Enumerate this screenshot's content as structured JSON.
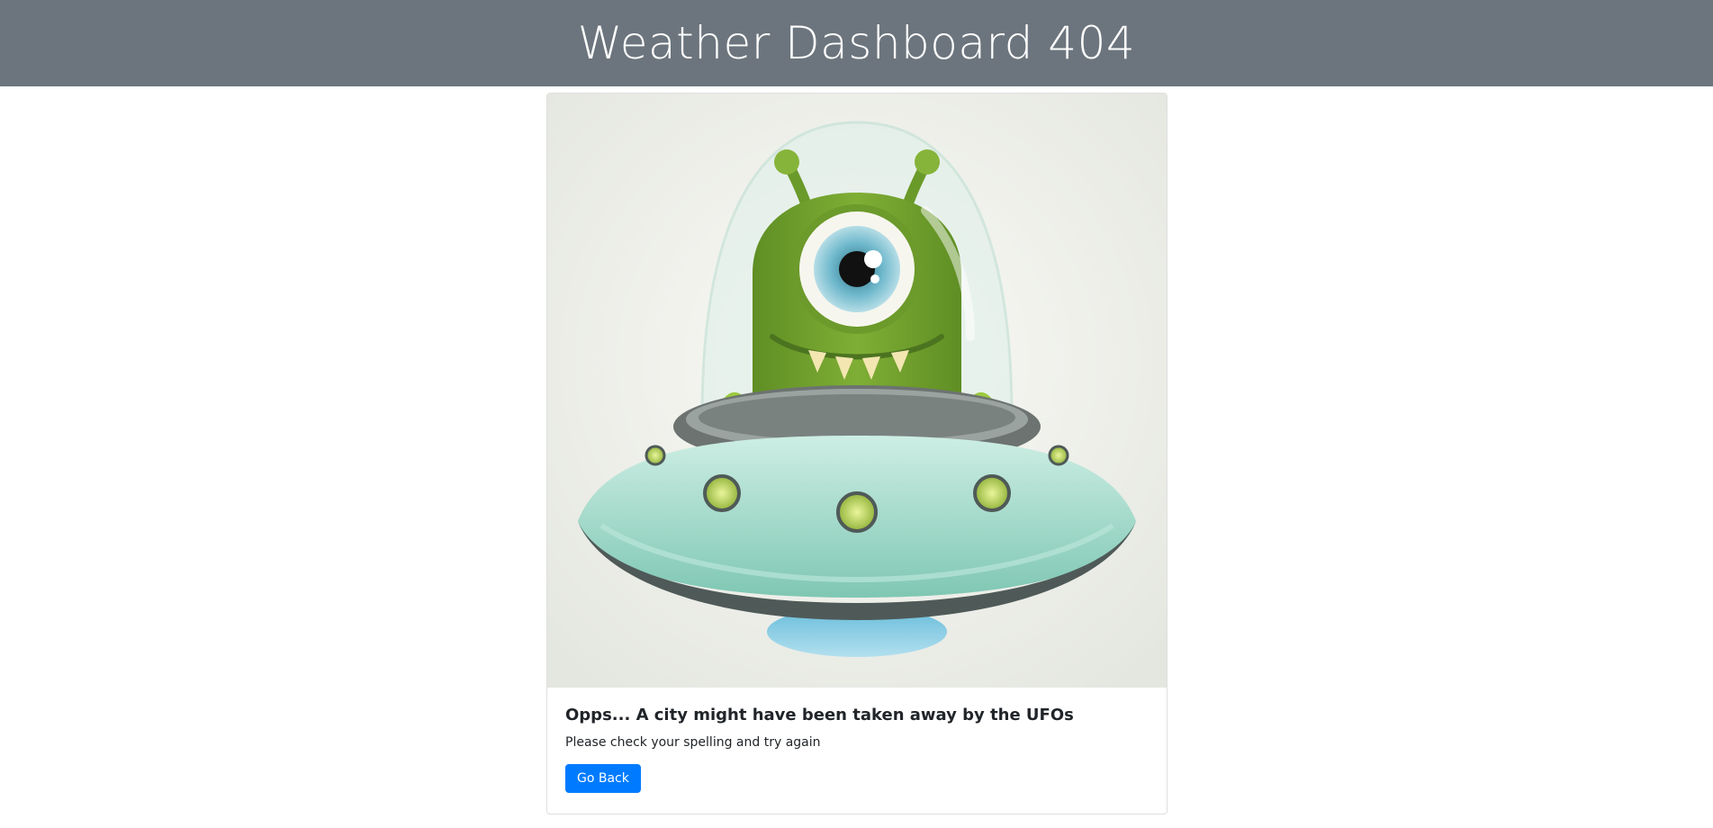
{
  "header": {
    "title": "Weather Dashboard 404"
  },
  "card": {
    "image_icon": "ufo-alien-illustration",
    "title": "Opps... A city might have been taken away by the UFOs",
    "text": "Please check your spelling and try again",
    "button_label": "Go Back"
  },
  "colors": {
    "header_bg": "#6c757d",
    "button_bg": "#007bff",
    "alien_green": "#7aa832",
    "ufo_teal": "#8fd1c0"
  }
}
